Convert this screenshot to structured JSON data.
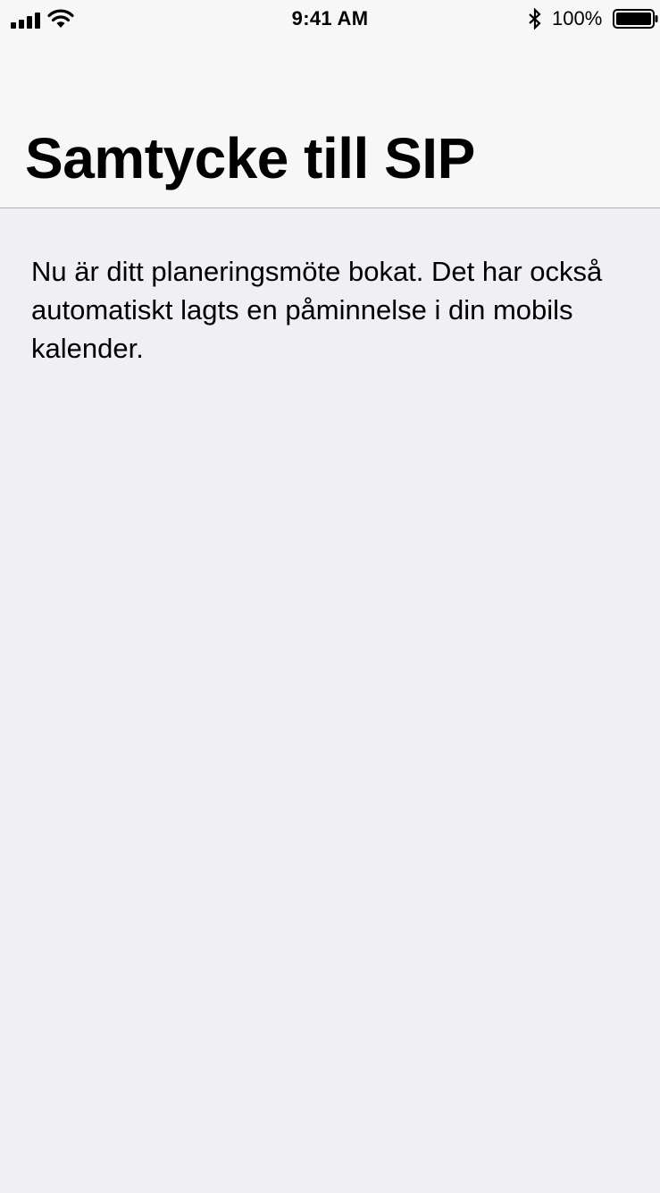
{
  "status_bar": {
    "time": "9:41 AM",
    "battery_percent": "100%",
    "battery_level": 1.0,
    "signal_bars": 4,
    "icons": [
      "signal-icon",
      "wifi-icon",
      "bluetooth-icon",
      "battery-icon"
    ]
  },
  "header": {
    "title": "Samtycke till SIP"
  },
  "content": {
    "message": "Nu är ditt planeringsmöte bokat. Det har också automatiskt lagts en påminnelse i din mobils kalender."
  },
  "colors": {
    "background": "#efeff4",
    "header_background": "#f7f7f7",
    "header_border": "#b2b2b2",
    "text": "#000000"
  }
}
